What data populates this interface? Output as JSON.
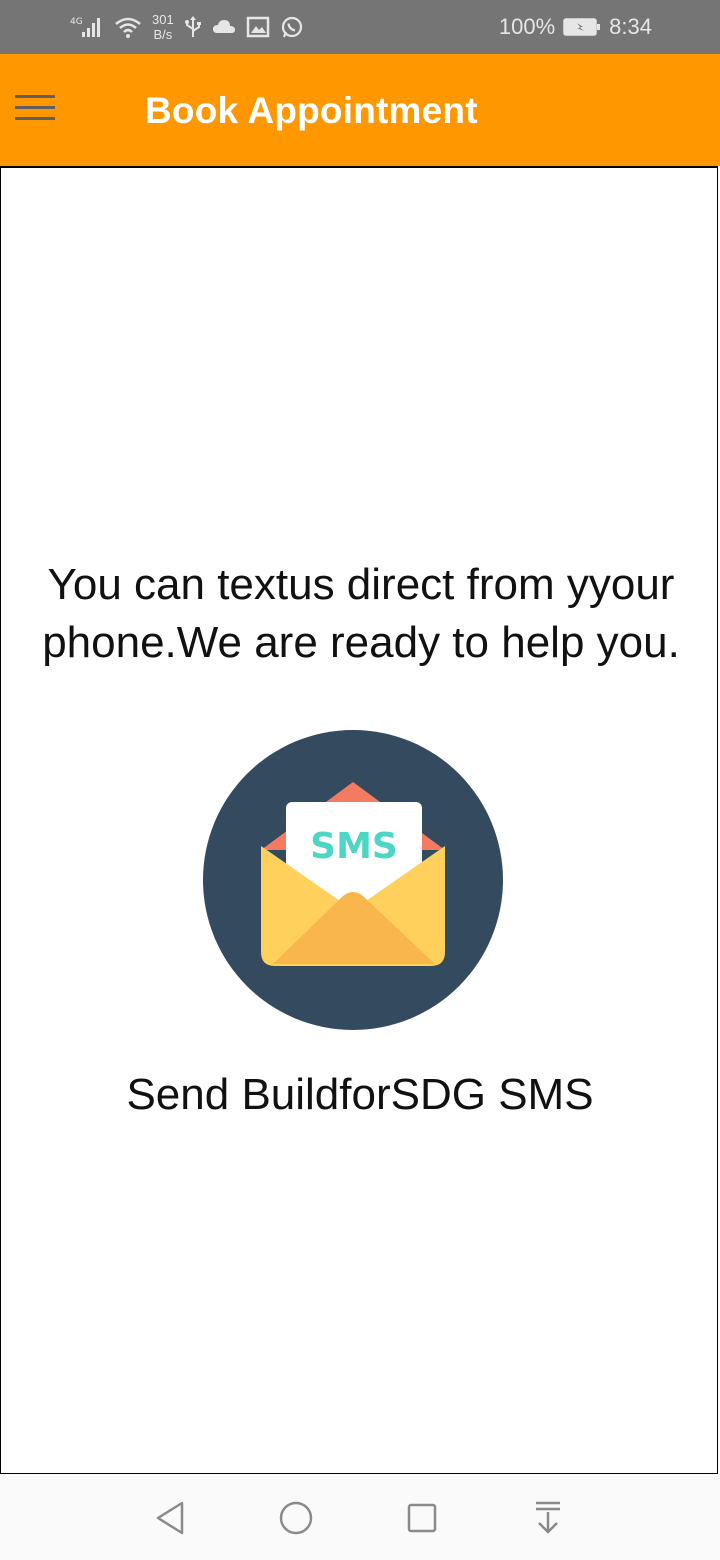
{
  "status_bar": {
    "net_speed_value": "301",
    "net_speed_unit": "B/s",
    "battery": "100%",
    "time": "8:34"
  },
  "app_bar": {
    "title": "Book Appointment",
    "menu_icon": "hamburger-menu-icon",
    "background_color": "#FF9800"
  },
  "content": {
    "message": "You can textus direct from yyour phone.We are ready to help you.",
    "illustration_text": "SMS",
    "send_link": "Send BuildforSDG SMS"
  },
  "nav_bar": {
    "icons": [
      "back-icon",
      "home-icon",
      "recents-icon",
      "notification-pull-icon"
    ]
  }
}
